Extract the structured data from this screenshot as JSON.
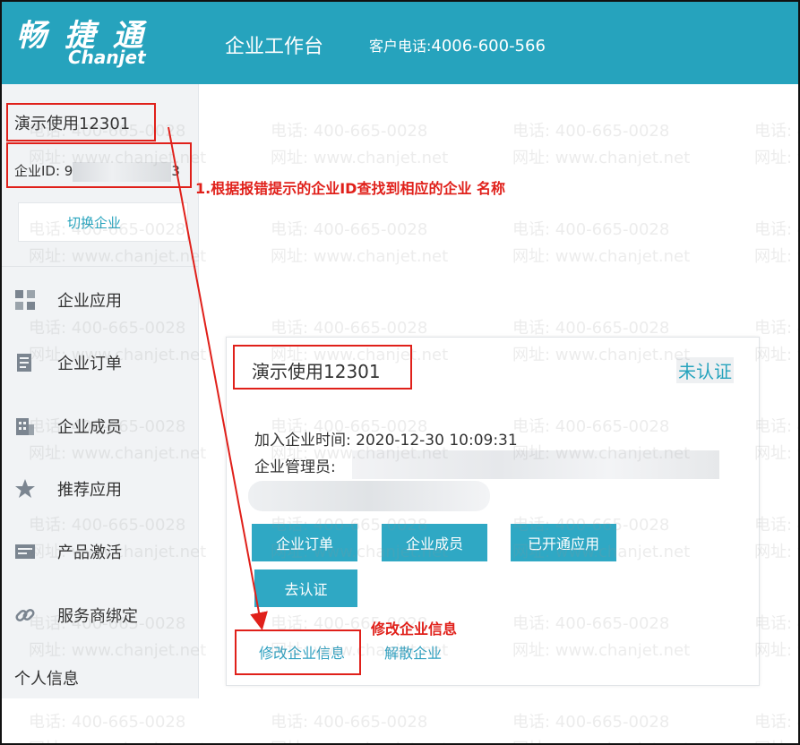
{
  "header": {
    "logo_cn": "畅 捷 通",
    "logo_en": "Chanjet",
    "title": "企业工作台",
    "hotline_label": "客户电话:",
    "hotline_number": "4006-600-566"
  },
  "sidebar": {
    "company_name": "演示使用12301",
    "company_id_label": "企业ID: 9",
    "company_id_suffix": "3",
    "switch_label": "切换企业",
    "items": [
      {
        "label": "企业应用",
        "icon": "grid-apps-icon"
      },
      {
        "label": "企业订单",
        "icon": "order-doc-icon"
      },
      {
        "label": "企业成员",
        "icon": "building-icon"
      },
      {
        "label": "推荐应用",
        "icon": "star-icon"
      },
      {
        "label": "产品激活",
        "icon": "card-icon"
      },
      {
        "label": "服务商绑定",
        "icon": "link-icon"
      }
    ],
    "personal_info": "个人信息"
  },
  "card": {
    "title": "演示使用12301",
    "status": "未认证",
    "join_time": "加入企业时间: 2020-12-30 10:09:31",
    "admin_label": "企业管理员:",
    "buttons": {
      "orders": "企业订单",
      "members": "企业成员",
      "opened_apps": "已开通应用",
      "certify": "去认证"
    },
    "edit_link": "修改企业信息",
    "dissolve_link": "解散企业"
  },
  "annotations": {
    "note1": "1.根据报错提示的企业ID查找到相应的企业 名称",
    "note2": "修改企业信息"
  },
  "watermark": {
    "phone": "电话: 400-665-0028",
    "site": "网址: www.chanjet.net"
  },
  "colors": {
    "header_bg": "#26a3bd",
    "accent": "#2fa8c4",
    "annotation_red": "#e0201a"
  }
}
